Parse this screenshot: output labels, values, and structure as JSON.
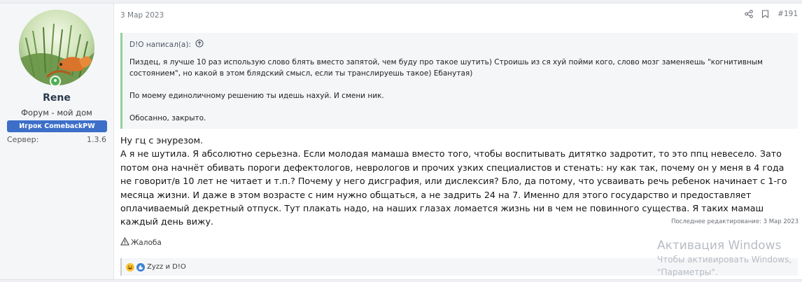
{
  "user": {
    "name": "Rene",
    "title": "Форум - мой дом",
    "banner": "Игрок ComebackPW",
    "server_label": "Сервер:",
    "server_value": "1.3.6"
  },
  "post": {
    "date": "3 Мар 2023",
    "number": "#191",
    "quote": {
      "header": "D!O написал(а):",
      "paragraphs": [
        "Пиздец, я лучше 10 раз использую слово блять вместо запятой, чем буду про такое шутить) Строишь из ся хуй пойми кого, слово мозг заменяешь \"когнитивным состоянием\", но какой в этом блядский смысл, если ты транслируешь такое) Ебанутая)",
        "По моему единоличному решению ты идешь нахуй. И смени ник.",
        "Обосанно, закрыто."
      ]
    },
    "message": [
      "Ну гц с энурезом.",
      "А я не шутила. Я абсолютно серьезна. Если молодая мамаша вместо того, чтобы воспитывать дитятко задротит, то это ппц невесело. Зато потом она начнёт обивать пороги дефектологов, неврологов и прочих узких специалистов и стенать: ну как так, почему он у меня в 4 года не говорит/в 10 лет не читает и т.п.? Почему у него дисграфия, или дислексия? Бло, да потому, что усваивать речь ребенок начинает с 1-го месяца жизни. И даже в этом возрасте с ним нужно общаться, а не задрить 24 на 7. Именно для этого государство и предоставляет оплачиваемый декретный отпуск. Тут плакать надо, на наших глазах ломается жизнь ни в чем не повинного существа. Я таких мамаш каждый день вижу."
    ],
    "edited": "Последнее редактирование: 3 Мар 2023",
    "report_label": "Жалоба",
    "reactions_text": "Zyzz и D!O"
  },
  "watermark": {
    "title": "Активация Windows",
    "line1": "Чтобы активировать Windows,",
    "line2": "\"Параметры\"."
  }
}
